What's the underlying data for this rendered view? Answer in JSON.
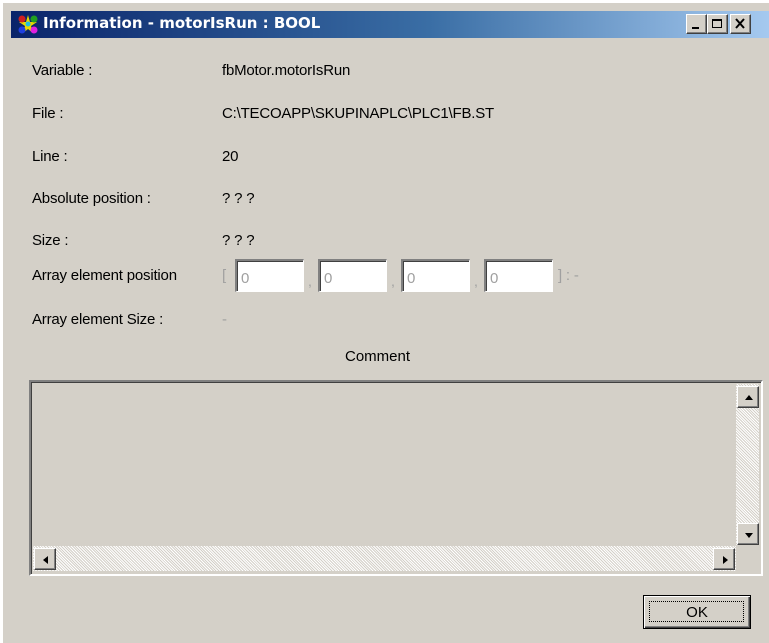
{
  "window": {
    "title": "Information - motorIsRun : BOOL",
    "app_icon": "colorful-star-app-icon",
    "controls": [
      "minimize-icon",
      "maximize-icon",
      "close-icon"
    ]
  },
  "fields": {
    "variable_label": "Variable :",
    "variable_value": "fbMotor.motorIsRun",
    "file_label": "File :",
    "file_value": "C:\\TECOAPP\\SKUPINAPLC\\PLC1\\FB.ST",
    "line_label": "Line :",
    "line_value": "20",
    "abs_position_label": "Absolute position :",
    "abs_position_value": "? ? ?",
    "size_label": "Size :",
    "size_value": "? ? ?",
    "array_pos_label": "Array element position",
    "array_open": "[",
    "array_sep": ",",
    "array_close": "] : -",
    "array_inputs": [
      "0",
      "0",
      "0",
      "0"
    ],
    "array_size_label": "Array element Size :",
    "array_size_value": "-"
  },
  "comment": {
    "label": "Comment",
    "text": ""
  },
  "buttons": {
    "ok_label": "OK"
  },
  "colors": {
    "titlebar_start": "#0a246a",
    "titlebar_end": "#a6caf0",
    "dialog_bg": "#d4d0c8"
  }
}
